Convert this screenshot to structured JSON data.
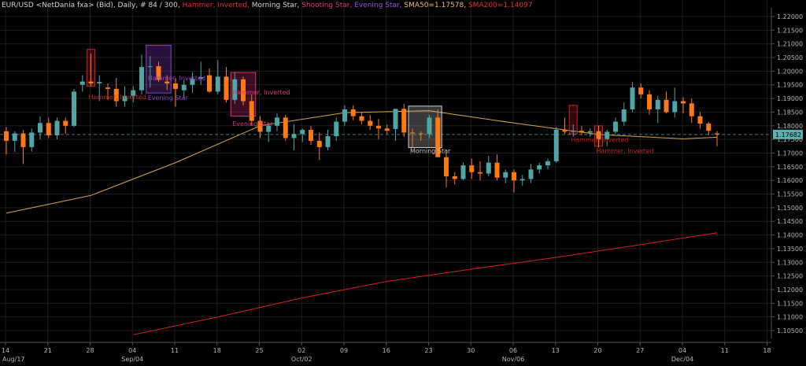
{
  "header": {
    "segments": [
      {
        "text": "EUR/USD <NetDania fxa> (Bid), Daily, # 84 / 300,",
        "color": "#d8d8d8"
      },
      {
        "text": " Hammer, Inverted,",
        "color": "#e03030"
      },
      {
        "text": " Morning Star,",
        "color": "#d8d8d8"
      },
      {
        "text": " Shooting Star,",
        "color": "#e03080"
      },
      {
        "text": " Evening Star,",
        "color": "#a050e0"
      },
      {
        "text": " SMA50=1.17578,",
        "color": "#e8c070"
      },
      {
        "text": " SMA200=1.14097",
        "color": "#e03030"
      }
    ]
  },
  "colors": {
    "background": "#000000",
    "grid": "#1e1e1e",
    "axis_text": "#b8b8b8",
    "bull": "#4ea6a6",
    "bear": "#ff7a14",
    "sma50": "#d9a94a",
    "sma200": "#d42222",
    "current_price_bg": "#5fb0b0",
    "hammer": "#c02020",
    "morning_star": "#cccccc",
    "evening_star": "#9040d0",
    "shooting_star": "#e03080"
  },
  "chart_data": {
    "type": "candlestick",
    "ylim": [
      1.1,
      1.225
    ],
    "grid": true,
    "y_ticks": [
      "1.10500",
      "1.11000",
      "1.11500",
      "1.12000",
      "1.12500",
      "1.13000",
      "1.13500",
      "1.14000",
      "1.14500",
      "1.15000",
      "1.15500",
      "1.16000",
      "1.16500",
      "1.17000",
      "1.17500",
      "1.18000",
      "1.18500",
      "1.19000",
      "1.19500",
      "1.20000",
      "1.20500",
      "1.21000",
      "1.21500",
      "1.22000"
    ],
    "x_ticks": [
      "14",
      "21",
      "28",
      "04",
      "11",
      "18",
      "25",
      "02",
      "09",
      "16",
      "23",
      "30",
      "06",
      "13",
      "20",
      "27",
      "04",
      "11",
      "18"
    ],
    "x_period_labels": [
      "Aug/17",
      "Sep/04",
      "Oct/02",
      "Nov/06",
      "Dec/04"
    ],
    "current_price": "1.17682",
    "candles": [
      {
        "o": 1.178,
        "h": 1.1795,
        "l": 1.1695,
        "c": 1.1745
      },
      {
        "o": 1.1745,
        "h": 1.178,
        "l": 1.1705,
        "c": 1.1772
      },
      {
        "o": 1.1772,
        "h": 1.1785,
        "l": 1.166,
        "c": 1.1722
      },
      {
        "o": 1.1722,
        "h": 1.179,
        "l": 1.1705,
        "c": 1.1775
      },
      {
        "o": 1.1775,
        "h": 1.1835,
        "l": 1.175,
        "c": 1.181
      },
      {
        "o": 1.181,
        "h": 1.183,
        "l": 1.1755,
        "c": 1.1765
      },
      {
        "o": 1.1765,
        "h": 1.183,
        "l": 1.175,
        "c": 1.1818
      },
      {
        "o": 1.1818,
        "h": 1.183,
        "l": 1.177,
        "c": 1.18
      },
      {
        "o": 1.18,
        "h": 1.1935,
        "l": 1.1795,
        "c": 1.1925
      },
      {
        "o": 1.195,
        "h": 1.1985,
        "l": 1.1925,
        "c": 1.1962
      },
      {
        "o": 1.1962,
        "h": 1.2065,
        "l": 1.1945,
        "c": 1.1955
      },
      {
        "o": 1.1955,
        "h": 1.1985,
        "l": 1.189,
        "c": 1.196
      },
      {
        "o": 1.194,
        "h": 1.1955,
        "l": 1.1895,
        "c": 1.1935
      },
      {
        "o": 1.1935,
        "h": 1.1975,
        "l": 1.187,
        "c": 1.189
      },
      {
        "o": 1.189,
        "h": 1.1945,
        "l": 1.187,
        "c": 1.191
      },
      {
        "o": 1.191,
        "h": 1.1945,
        "l": 1.1885,
        "c": 1.193
      },
      {
        "o": 1.193,
        "h": 1.206,
        "l": 1.1915,
        "c": 1.2015
      },
      {
        "o": 1.2015,
        "h": 1.2055,
        "l": 1.194,
        "c": 1.2018
      },
      {
        "o": 1.2018,
        "h": 1.2035,
        "l": 1.196,
        "c": 1.1968
      },
      {
        "o": 1.1962,
        "h": 1.1985,
        "l": 1.193,
        "c": 1.1955
      },
      {
        "o": 1.1955,
        "h": 1.1975,
        "l": 1.187,
        "c": 1.1935
      },
      {
        "o": 1.193,
        "h": 1.197,
        "l": 1.19,
        "c": 1.195
      },
      {
        "o": 1.195,
        "h": 1.1995,
        "l": 1.192,
        "c": 1.1972
      },
      {
        "o": 1.1972,
        "h": 1.2035,
        "l": 1.195,
        "c": 1.1978
      },
      {
        "o": 1.1985,
        "h": 1.201,
        "l": 1.192,
        "c": 1.1925
      },
      {
        "o": 1.1925,
        "h": 1.204,
        "l": 1.1915,
        "c": 1.198
      },
      {
        "o": 1.198,
        "h": 1.2015,
        "l": 1.1885,
        "c": 1.1895
      },
      {
        "o": 1.1895,
        "h": 1.1995,
        "l": 1.188,
        "c": 1.197
      },
      {
        "o": 1.197,
        "h": 1.198,
        "l": 1.1875,
        "c": 1.189
      },
      {
        "o": 1.189,
        "h": 1.1915,
        "l": 1.18,
        "c": 1.1818
      },
      {
        "o": 1.1818,
        "h": 1.1835,
        "l": 1.1755,
        "c": 1.1778
      },
      {
        "o": 1.1778,
        "h": 1.181,
        "l": 1.174,
        "c": 1.18
      },
      {
        "o": 1.18,
        "h": 1.1845,
        "l": 1.178,
        "c": 1.183
      },
      {
        "o": 1.183,
        "h": 1.184,
        "l": 1.1745,
        "c": 1.1755
      },
      {
        "o": 1.1755,
        "h": 1.1805,
        "l": 1.171,
        "c": 1.177
      },
      {
        "o": 1.177,
        "h": 1.179,
        "l": 1.174,
        "c": 1.1785
      },
      {
        "o": 1.1785,
        "h": 1.18,
        "l": 1.173,
        "c": 1.1745
      },
      {
        "o": 1.1745,
        "h": 1.1775,
        "l": 1.1675,
        "c": 1.1722
      },
      {
        "o": 1.1722,
        "h": 1.1785,
        "l": 1.171,
        "c": 1.1762
      },
      {
        "o": 1.1762,
        "h": 1.183,
        "l": 1.1745,
        "c": 1.1815
      },
      {
        "o": 1.1815,
        "h": 1.1875,
        "l": 1.18,
        "c": 1.186
      },
      {
        "o": 1.186,
        "h": 1.1875,
        "l": 1.182,
        "c": 1.1835
      },
      {
        "o": 1.1835,
        "h": 1.185,
        "l": 1.1805,
        "c": 1.1818
      },
      {
        "o": 1.1818,
        "h": 1.184,
        "l": 1.1785,
        "c": 1.18
      },
      {
        "o": 1.18,
        "h": 1.1825,
        "l": 1.175,
        "c": 1.179
      },
      {
        "o": 1.179,
        "h": 1.1805,
        "l": 1.177,
        "c": 1.1782
      },
      {
        "o": 1.1788,
        "h": 1.1855,
        "l": 1.1745,
        "c": 1.1862
      },
      {
        "o": 1.1862,
        "h": 1.188,
        "l": 1.176,
        "c": 1.1775
      },
      {
        "o": 1.1775,
        "h": 1.179,
        "l": 1.172,
        "c": 1.1772
      },
      {
        "o": 1.1772,
        "h": 1.178,
        "l": 1.1745,
        "c": 1.177
      },
      {
        "o": 1.177,
        "h": 1.184,
        "l": 1.1755,
        "c": 1.183
      },
      {
        "o": 1.183,
        "h": 1.186,
        "l": 1.177,
        "c": 1.1685
      },
      {
        "o": 1.1685,
        "h": 1.17,
        "l": 1.1575,
        "c": 1.1615
      },
      {
        "o": 1.1615,
        "h": 1.163,
        "l": 1.1585,
        "c": 1.1605
      },
      {
        "o": 1.1605,
        "h": 1.1665,
        "l": 1.16,
        "c": 1.1655
      },
      {
        "o": 1.1655,
        "h": 1.168,
        "l": 1.1605,
        "c": 1.163
      },
      {
        "o": 1.163,
        "h": 1.167,
        "l": 1.16,
        "c": 1.1625
      },
      {
        "o": 1.1625,
        "h": 1.169,
        "l": 1.1615,
        "c": 1.1665
      },
      {
        "o": 1.1665,
        "h": 1.1695,
        "l": 1.16,
        "c": 1.161
      },
      {
        "o": 1.161,
        "h": 1.164,
        "l": 1.159,
        "c": 1.163
      },
      {
        "o": 1.163,
        "h": 1.164,
        "l": 1.1555,
        "c": 1.16
      },
      {
        "o": 1.16,
        "h": 1.162,
        "l": 1.158,
        "c": 1.1605
      },
      {
        "o": 1.1605,
        "h": 1.166,
        "l": 1.159,
        "c": 1.164
      },
      {
        "o": 1.164,
        "h": 1.1665,
        "l": 1.1625,
        "c": 1.1655
      },
      {
        "o": 1.1655,
        "h": 1.168,
        "l": 1.164,
        "c": 1.167
      },
      {
        "o": 1.167,
        "h": 1.1795,
        "l": 1.1665,
        "c": 1.1785
      },
      {
        "o": 1.1785,
        "h": 1.183,
        "l": 1.177,
        "c": 1.1778
      },
      {
        "o": 1.1778,
        "h": 1.1805,
        "l": 1.176,
        "c": 1.1782
      },
      {
        "o": 1.1782,
        "h": 1.18,
        "l": 1.1765,
        "c": 1.1775
      },
      {
        "o": 1.1775,
        "h": 1.179,
        "l": 1.176,
        "c": 1.178
      },
      {
        "o": 1.178,
        "h": 1.18,
        "l": 1.172,
        "c": 1.175
      },
      {
        "o": 1.175,
        "h": 1.1785,
        "l": 1.1725,
        "c": 1.1778
      },
      {
        "o": 1.1778,
        "h": 1.183,
        "l": 1.177,
        "c": 1.1815
      },
      {
        "o": 1.1815,
        "h": 1.1885,
        "l": 1.18,
        "c": 1.186
      },
      {
        "o": 1.186,
        "h": 1.196,
        "l": 1.185,
        "c": 1.194
      },
      {
        "o": 1.194,
        "h": 1.1955,
        "l": 1.19,
        "c": 1.1915
      },
      {
        "o": 1.1915,
        "h": 1.193,
        "l": 1.184,
        "c": 1.186
      },
      {
        "o": 1.186,
        "h": 1.191,
        "l": 1.181,
        "c": 1.1895
      },
      {
        "o": 1.1895,
        "h": 1.1925,
        "l": 1.1845,
        "c": 1.185
      },
      {
        "o": 1.185,
        "h": 1.194,
        "l": 1.183,
        "c": 1.189
      },
      {
        "o": 1.189,
        "h": 1.1905,
        "l": 1.1845,
        "c": 1.1882
      },
      {
        "o": 1.1882,
        "h": 1.19,
        "l": 1.181,
        "c": 1.1835
      },
      {
        "o": 1.1835,
        "h": 1.185,
        "l": 1.179,
        "c": 1.1808
      },
      {
        "o": 1.1808,
        "h": 1.1815,
        "l": 1.1765,
        "c": 1.1782
      },
      {
        "o": 1.1772,
        "h": 1.178,
        "l": 1.1725,
        "c": 1.1768
      }
    ],
    "sma50": {
      "x": [
        0,
        10,
        20,
        30,
        40,
        50,
        60,
        70,
        80,
        84
      ],
      "y": [
        1.148,
        1.1545,
        1.1665,
        1.18,
        1.1848,
        1.1855,
        1.181,
        1.1768,
        1.1752,
        1.1758
      ]
    },
    "sma200": {
      "x": [
        15,
        25,
        35,
        45,
        55,
        65,
        75,
        84
      ],
      "y": [
        1.1035,
        1.11,
        1.117,
        1.123,
        1.1275,
        1.1318,
        1.1365,
        1.1408
      ]
    },
    "patterns": [
      {
        "type": "hammer",
        "label": "Hammer, Inverted",
        "from": 10,
        "to": 10,
        "hi": 1.208,
        "lo": 1.1945,
        "label_price": 1.1898
      },
      {
        "type": "evening_star",
        "label": "Hammer, Inverted",
        "from": 17,
        "to": 19,
        "hi": 1.2095,
        "lo": 1.192,
        "label_price": 1.1967
      },
      {
        "type": "evening_star",
        "label": "Evening Star",
        "from": 17,
        "to": 19,
        "hi": 1.2095,
        "lo": 1.192,
        "label_price": 1.1895
      },
      {
        "type": "shooting_star",
        "label": "Hammer, Inverted",
        "from": 27,
        "to": 29,
        "hi": 1.1995,
        "lo": 1.1835,
        "label_price": 1.1915
      },
      {
        "type": "shooting_star",
        "label": "Evening Star",
        "from": 27,
        "to": 29,
        "hi": 1.1995,
        "lo": 1.1835,
        "label_price": 1.18
      },
      {
        "type": "morning_star",
        "label": "Morning Star",
        "from": 48,
        "to": 51,
        "hi": 1.1872,
        "lo": 1.172,
        "label_price": 1.17
      },
      {
        "type": "hammer",
        "label": "Hammer, Inverted",
        "from": 67,
        "to": 67,
        "hi": 1.1875,
        "lo": 1.177,
        "label_price": 1.174
      },
      {
        "type": "hammer",
        "label": "Hammer, Inverted",
        "from": 70,
        "to": 70,
        "hi": 1.18,
        "lo": 1.1725,
        "label_price": 1.17
      }
    ]
  }
}
